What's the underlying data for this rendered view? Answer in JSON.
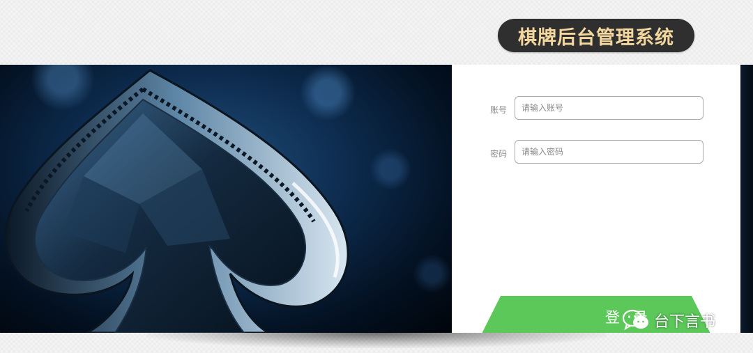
{
  "header": {
    "title": "棋牌后台管理系统"
  },
  "form": {
    "account": {
      "label": "账号",
      "placeholder": "请输入账号",
      "value": ""
    },
    "password": {
      "label": "密码",
      "placeholder": "请输入密码",
      "value": ""
    },
    "submit_label": "登 录"
  },
  "watermark": {
    "icon": "wechat-icon",
    "text": "台下言书"
  },
  "colors": {
    "title_bg": "#2f2f2f",
    "title_text": "#f3d79e",
    "button": "#5cc85a",
    "banner": "#0c2a4c"
  }
}
